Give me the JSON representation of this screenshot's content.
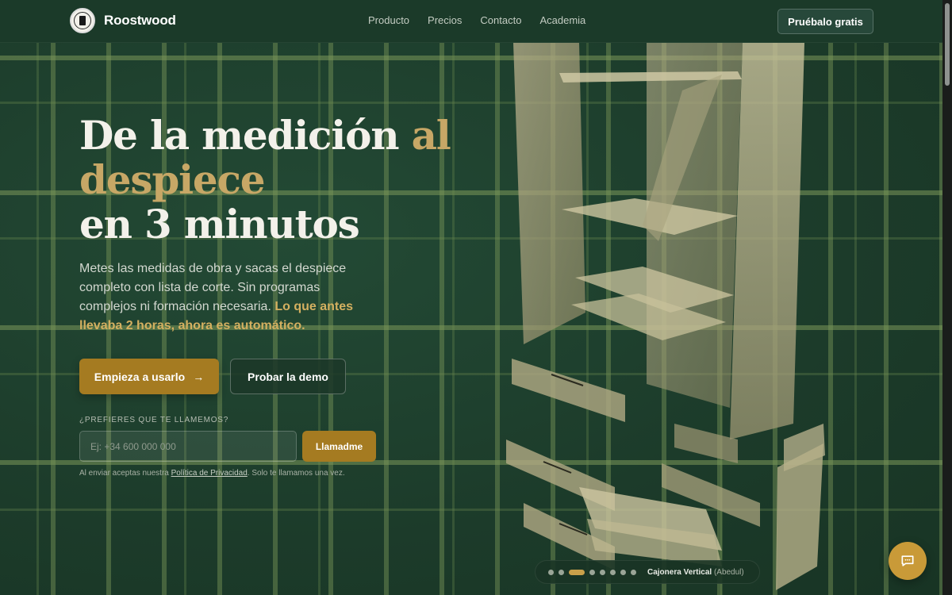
{
  "header": {
    "brand": "Roostwood",
    "nav": [
      "Producto",
      "Precios",
      "Contacto",
      "Academia"
    ],
    "cta": "Pruébalo gratis"
  },
  "hero": {
    "title_line1_a": "De la medición ",
    "title_line1_b": "al",
    "title_line2": "despiece",
    "title_line3": "en 3 minutos",
    "lead_text": "Metes las medidas de obra y sacas el despiece completo con lista de corte. Sin programas complejos ni formación necesaria. ",
    "lead_highlight": "Lo que antes llevaba 2 horas, ahora es automático.",
    "primary_button": "Empieza a usarlo",
    "primary_arrow": "→",
    "secondary_button": "Probar la demo"
  },
  "callback": {
    "label": "¿PREFIERES QUE TE LLAMEMOS?",
    "placeholder": "Ej: +34 600 000 000",
    "button": "Llamadme",
    "privacy_before": "Al enviar aceptas nuestra ",
    "privacy_link": "Política de Privacidad",
    "privacy_after": ". Solo te llamamos una vez."
  },
  "carousel": {
    "dot_count": 8,
    "active_index": 2,
    "label": "Cajonera Vertical",
    "label_sub": "(Abedul)"
  },
  "icons": {
    "chat": "chat-bubble-icon",
    "logo": "roostwood-logo"
  },
  "colors": {
    "background": "#1d3d2c",
    "accent_gold": "#c7a766",
    "button_gold": "#a57b21",
    "chat_button": "#c99a38"
  }
}
